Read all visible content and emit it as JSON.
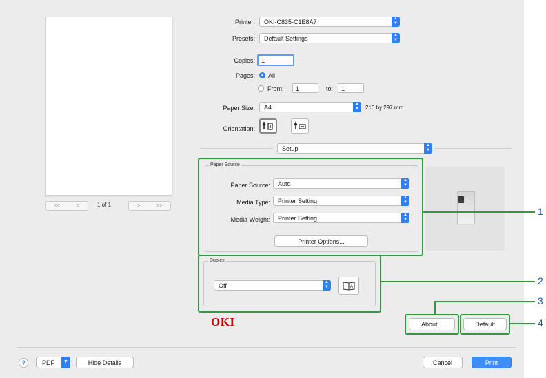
{
  "printer": {
    "label": "Printer:",
    "value": "OKI-C835-C1E8A7"
  },
  "presets": {
    "label": "Presets:",
    "value": "Default Settings"
  },
  "copies": {
    "label": "Copies:",
    "value": "1"
  },
  "pages": {
    "label": "Pages:",
    "all_label": "All",
    "from_label": "From:",
    "from_value": "1",
    "to_label": "to:",
    "to_value": "1"
  },
  "paper_size": {
    "label": "Paper Size:",
    "value": "A4",
    "dimensions": "210 by 297 mm"
  },
  "orientation": {
    "label": "Orientation:"
  },
  "preview": {
    "page_indicator": "1 of 1",
    "first": "<<",
    "prev": "<",
    "next": ">",
    "last": ">>"
  },
  "section_popup": {
    "value": "Setup"
  },
  "paper_source_group": {
    "title": "Paper Source",
    "paper_source_label": "Paper Source:",
    "paper_source_value": "Auto",
    "media_type_label": "Media Type:",
    "media_type_value": "Printer Setting",
    "media_weight_label": "Media Weight:",
    "media_weight_value": "Printer Setting",
    "options_button": "Printer Options..."
  },
  "duplex_group": {
    "title": "Duplex",
    "value": "Off"
  },
  "brand": {
    "logo_text": "OKI"
  },
  "buttons": {
    "about": "About...",
    "default": "Default",
    "pdf": "PDF",
    "hide_details": "Hide Details",
    "cancel": "Cancel",
    "print": "Print",
    "help": "?"
  },
  "callouts": [
    "1",
    "2",
    "3",
    "4"
  ],
  "colors": {
    "accent": "#2e7ef4",
    "highlight_box": "#2e9c3c",
    "callout_text": "#1f5fae",
    "logo": "#cc0000"
  }
}
